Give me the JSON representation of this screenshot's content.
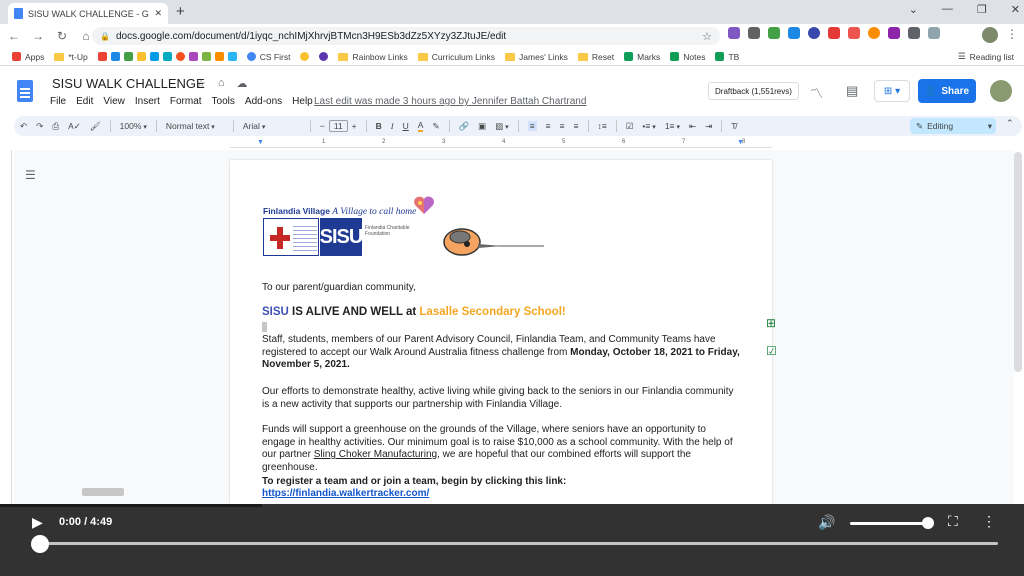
{
  "browser": {
    "tab_title": "SISU WALK CHALLENGE - Google",
    "url": "docs.google.com/document/d/1iyqc_nchIMjXhrvjBTMcn3H9ESb3dZz5XYzy3ZJtuJE/edit",
    "bookmarks": [
      "Apps",
      "*t-Up",
      "CS First",
      "Rainbow Links",
      "Curriculum Links",
      "James' Links",
      "Reset",
      "Marks",
      "Notes",
      "TB"
    ],
    "reading_list": "Reading list"
  },
  "docs": {
    "title": "SISU WALK CHALLENGE",
    "menus": [
      "File",
      "Edit",
      "View",
      "Insert",
      "Format",
      "Tools",
      "Add-ons",
      "Help"
    ],
    "last_edit": "Last edit was made 3 hours ago by Jennifer Battah Chartrand",
    "draftback": "Draftback (1,551revs)",
    "share": "Share",
    "toolbar": {
      "zoom": "100%",
      "style": "Normal text",
      "font": "Arial",
      "size": "11",
      "mode": "Editing"
    },
    "ruler_numbers": [
      "1",
      "2",
      "3",
      "4",
      "5",
      "6",
      "7",
      "8"
    ]
  },
  "logo": {
    "village": "Finlandia Village",
    "tagline": "A Village to call home",
    "sisu": "SISU",
    "foundation": "Finlandia Charitable Foundation"
  },
  "content": {
    "greeting": "To our parent/guardian community,",
    "heading_sisu": "SISU",
    "heading_mid": " IS ALIVE AND WELL at ",
    "heading_school": "Lasalle Secondary School!",
    "p1_a": "Staff, students, members of our Parent Advisory Council, Finlandia Team, and Community Teams have registered to accept our Walk Around Australia fitness challenge from ",
    "p1_b": "Monday, October 18, 2021 to Friday, November 5, 2021.",
    "p2": "Our efforts to demonstrate healthy, active living while giving back to the seniors in our Finlandia community is a new activity that supports our partnership with Finlandia Village.",
    "p3_a": "Funds will support a greenhouse on the grounds of the Village, where seniors have an opportunity to engage in healthy activities. Our minimum goal is to raise $10,000 as a school community. With the help of our partner ",
    "p3_link": "Sling Choker Manufacturing",
    "p3_b": ", we are hopeful that our combined efforts will support the greenhouse.",
    "p4": "To register a team and or join a team, begin by clicking this link:",
    "p4_link": "https://finlandia.walkertracker.com/"
  },
  "player": {
    "time": "0:00 / 4:49",
    "progress": 0,
    "volume": 0.95
  }
}
